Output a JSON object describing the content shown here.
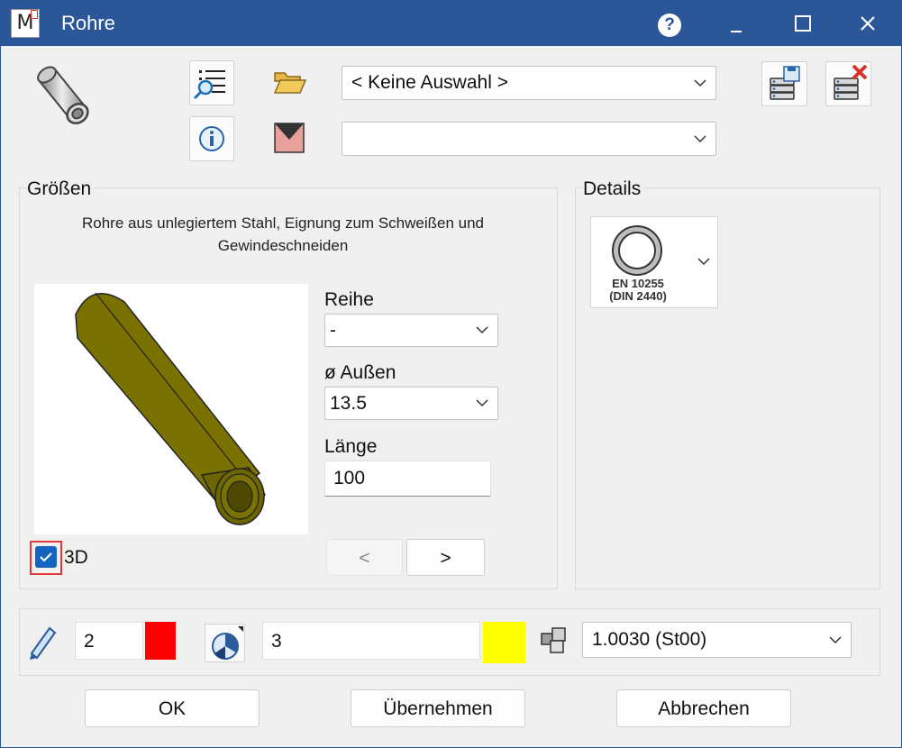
{
  "window": {
    "title": "Rohre"
  },
  "toolbar": {
    "catalog_select": {
      "value": "< Keine Auswahl >"
    },
    "second_select": {
      "value": ""
    }
  },
  "sizes": {
    "group_label": "Größen",
    "description": "Rohre aus unlegiertem Stahl, Eignung zum Schweißen und Gewindeschneiden",
    "reihe": {
      "label": "Reihe",
      "value": "-"
    },
    "outer_diameter": {
      "label": "ø Außen",
      "value": "13.5"
    },
    "length": {
      "label": "Länge",
      "value": "100"
    },
    "checkbox_3d": {
      "label": "3D",
      "checked": true
    },
    "prev_label": "<",
    "next_label": ">"
  },
  "details": {
    "group_label": "Details",
    "norm_line1": "EN 10255",
    "norm_line2": "(DIN 2440)"
  },
  "bottom": {
    "pen_value": "2",
    "pen_color": "#ff0000",
    "layer_value": "3",
    "layer_color": "#ffff00",
    "material_value": "1.0030 (St00)"
  },
  "buttons": {
    "ok": "OK",
    "apply": "Übernehmen",
    "cancel": "Abbrechen"
  },
  "colors": {
    "titlebar": "#2b579a",
    "pipe": "#7a7200",
    "checkbox": "#1565c0",
    "focus_outline": "#e53935"
  }
}
